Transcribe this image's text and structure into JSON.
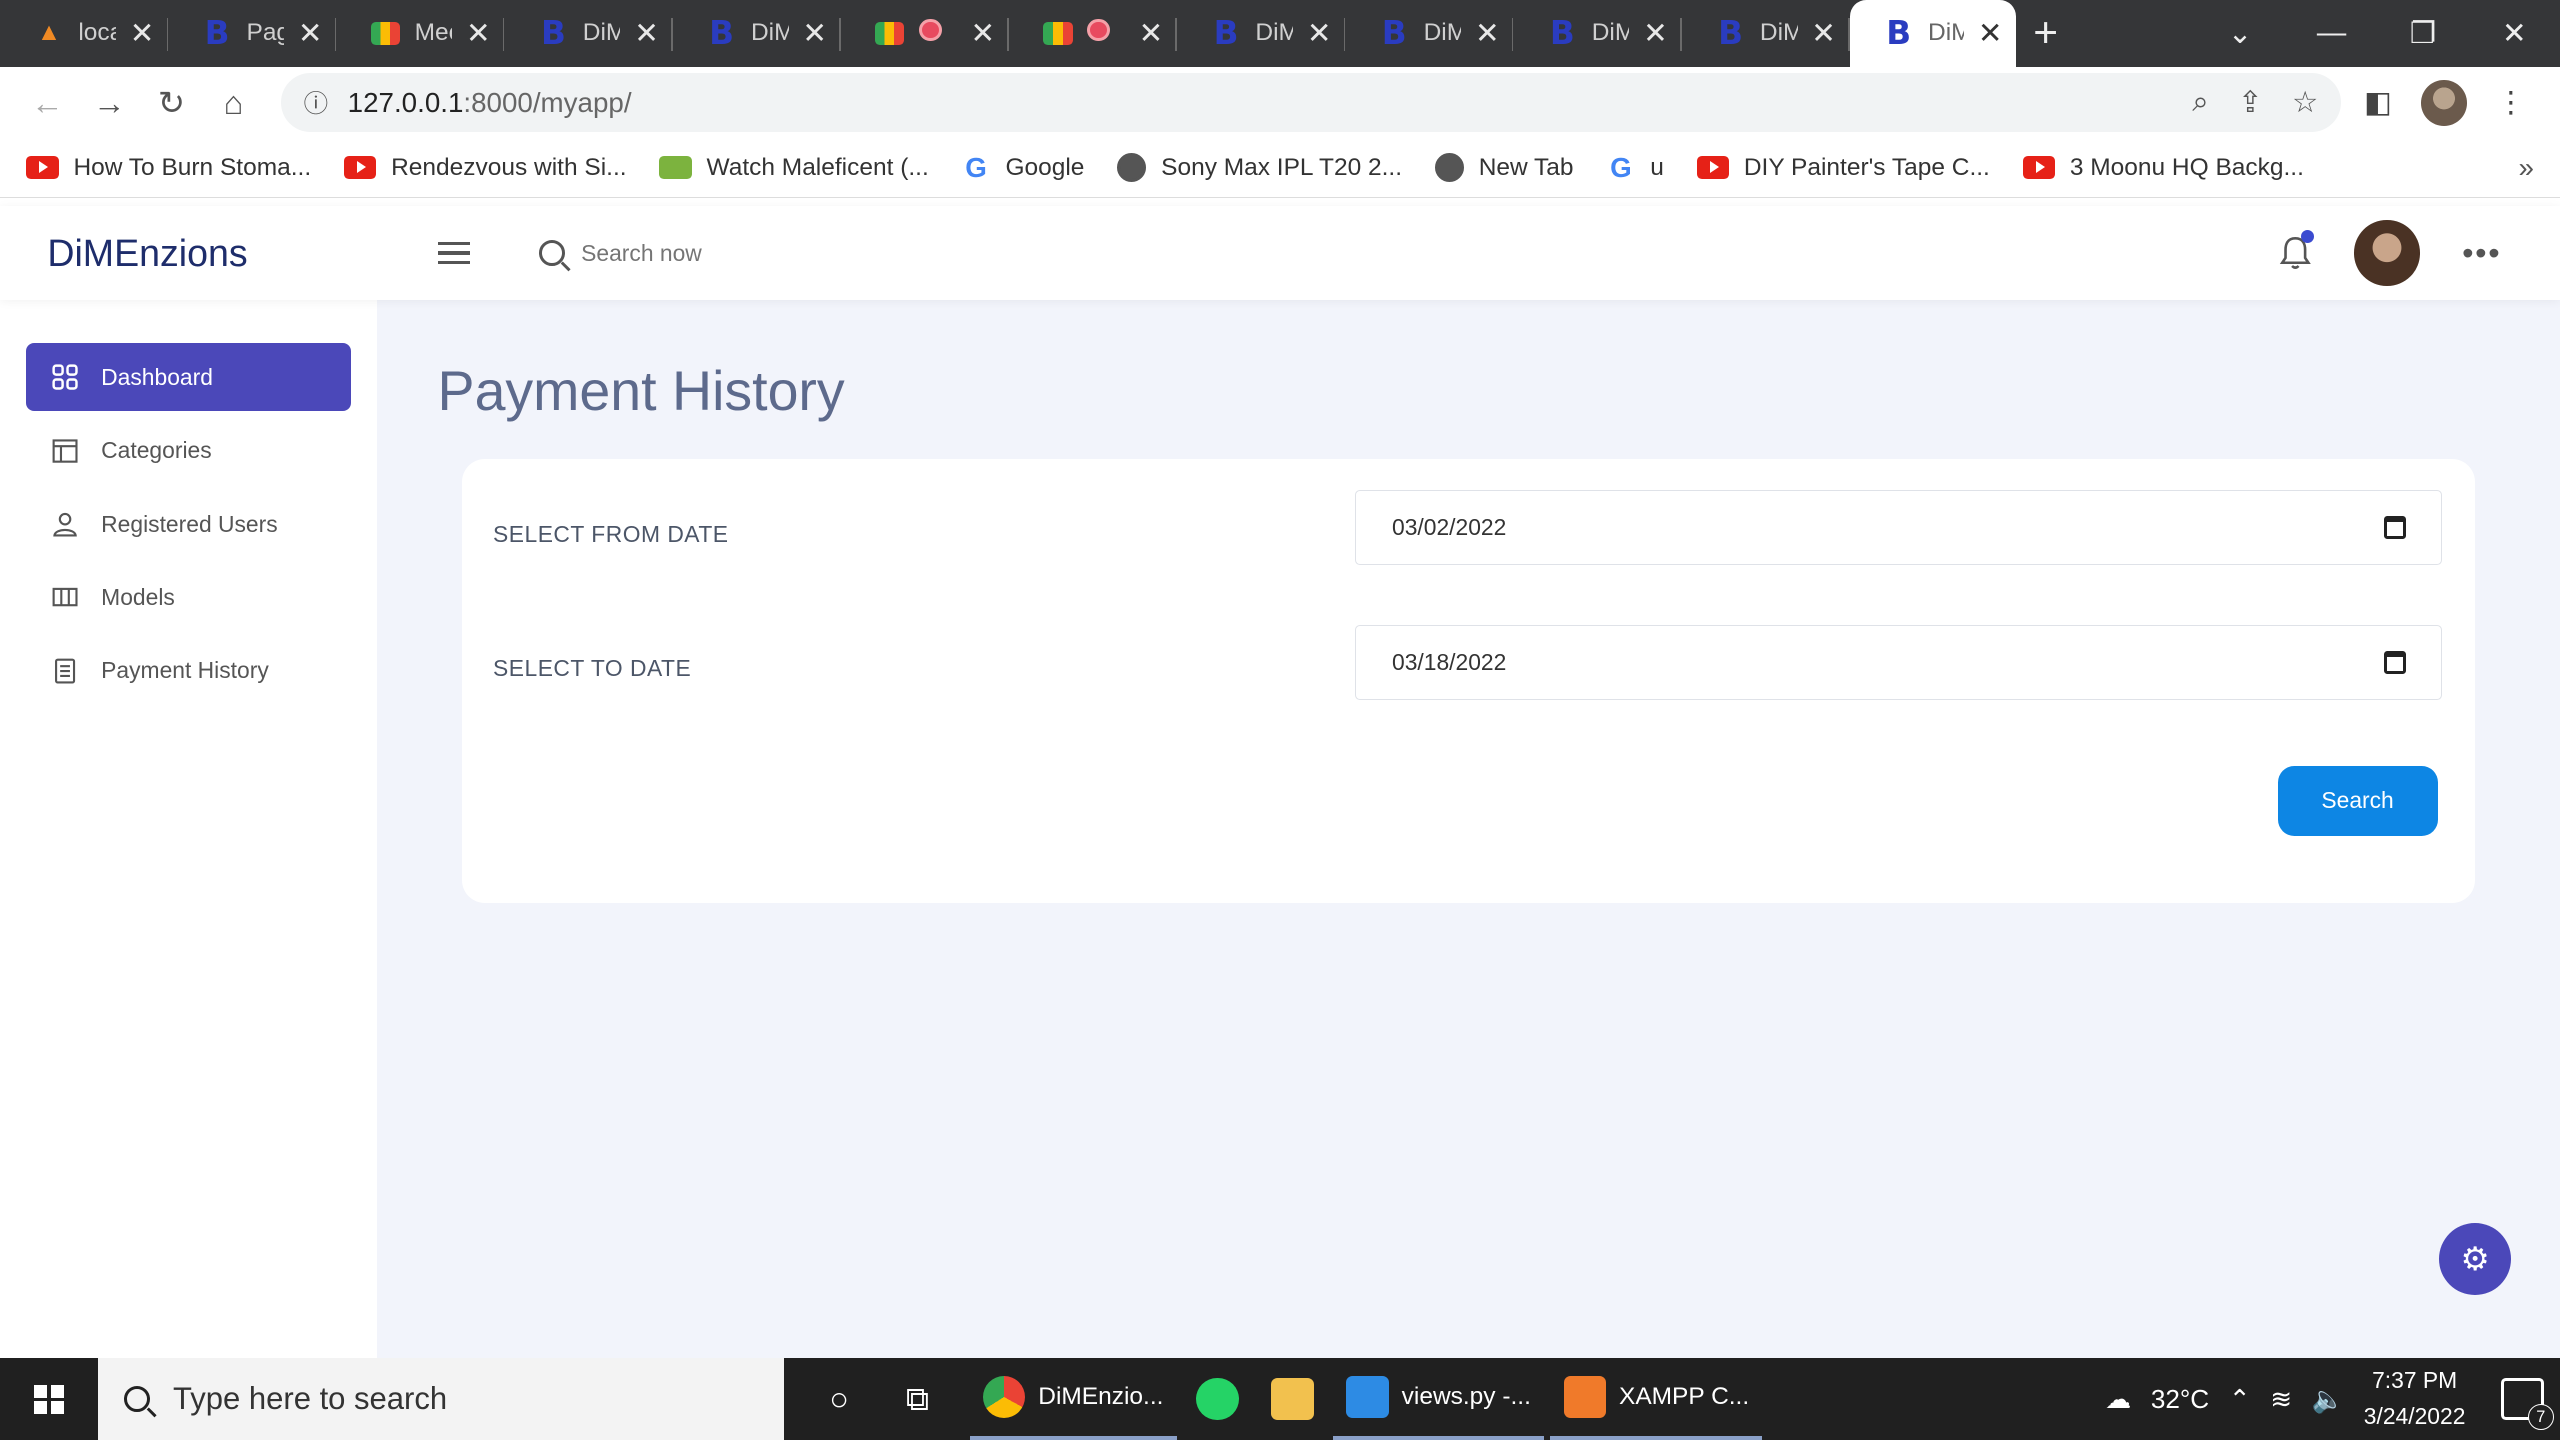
{
  "browser": {
    "tabs": [
      {
        "title": "loca",
        "favicon": "xampp-icon"
      },
      {
        "title": "Pag",
        "favicon": "b-icon"
      },
      {
        "title": "Mee",
        "favicon": "meet-icon"
      },
      {
        "title": "DiM",
        "favicon": "b-icon"
      },
      {
        "title": "DiM",
        "favicon": "b-icon"
      },
      {
        "title": "",
        "favicon": "meet-icon"
      },
      {
        "title": "",
        "favicon": "meet-icon"
      },
      {
        "title": "DiM",
        "favicon": "b-icon"
      },
      {
        "title": "DiM",
        "favicon": "b-icon"
      },
      {
        "title": "DiM",
        "favicon": "b-icon"
      },
      {
        "title": "DiM",
        "favicon": "b-icon"
      },
      {
        "title": "DiM",
        "favicon": "b-icon",
        "active": true
      }
    ],
    "url_host": "127.0.0.1",
    "url_path": ":8000/myapp/",
    "bookmarks": [
      {
        "label": "How To Burn Stoma...",
        "icon": "youtube-icon"
      },
      {
        "label": "Rendezvous with Si...",
        "icon": "youtube-icon"
      },
      {
        "label": "Watch Maleficent (...",
        "icon": "play-icon"
      },
      {
        "label": "Google",
        "icon": "google-icon"
      },
      {
        "label": "Sony Max IPL T20 2...",
        "icon": "globe-icon"
      },
      {
        "label": "New Tab",
        "icon": "globe-icon"
      },
      {
        "label": "u",
        "icon": "google-icon"
      },
      {
        "label": "DIY Painter's Tape C...",
        "icon": "youtube-icon"
      },
      {
        "label": "3 Moonu HQ Backg...",
        "icon": "youtube-icon"
      }
    ],
    "bookmarks_more": "»"
  },
  "app": {
    "brand": "DiMEnzions",
    "search_placeholder": "Search now",
    "sidebar": [
      {
        "label": "Dashboard",
        "icon": "grid-icon",
        "active": true
      },
      {
        "label": "Categories",
        "icon": "layout-icon"
      },
      {
        "label": "Registered Users",
        "icon": "user-icon"
      },
      {
        "label": "Models",
        "icon": "columns-icon"
      },
      {
        "label": "Payment History",
        "icon": "document-icon"
      }
    ],
    "page_title": "Payment History",
    "form": {
      "from_label": "SELECT FROM DATE",
      "from_value": "03/02/2022",
      "to_label": "SELECT TO DATE",
      "to_value": "03/18/2022",
      "search_label": "Search"
    }
  },
  "taskbar": {
    "search_placeholder": "Type here to search",
    "apps": [
      {
        "label": "DiMEnzio...",
        "icon": "chrome-icon"
      },
      {
        "label": "",
        "icon": "whatsapp-icon"
      },
      {
        "label": "",
        "icon": "folder-icon"
      },
      {
        "label": "views.py -...",
        "icon": "vscode-icon"
      },
      {
        "label": "XAMPP C...",
        "icon": "xampp-icon"
      }
    ],
    "weather": "32°C",
    "time": "7:37 PM",
    "date": "3/24/2022",
    "notification_count": "7"
  },
  "colors": {
    "accent": "#4b48b9",
    "button": "#0d86e4",
    "content_bg": "#f2f4fb"
  }
}
